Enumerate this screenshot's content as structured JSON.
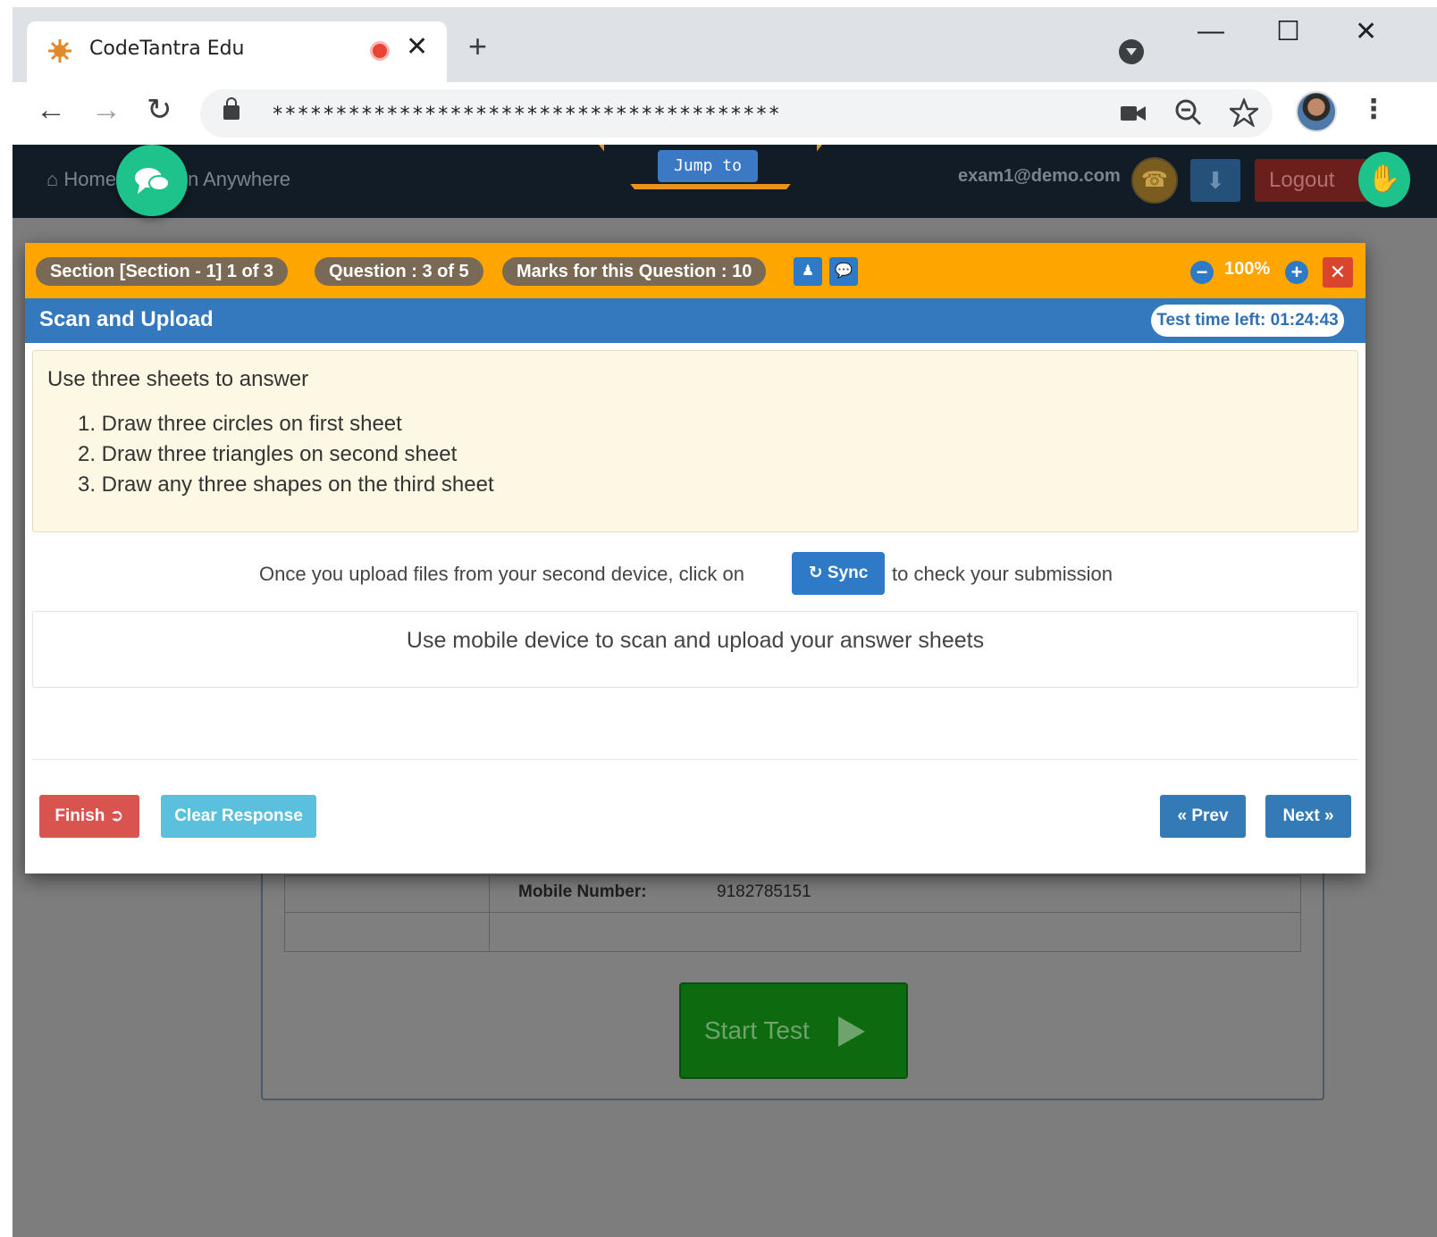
{
  "browser": {
    "tab_title": "CodeTantra Edu",
    "tab_close": "✕",
    "new_tab": "+",
    "url": "****************************************",
    "window_controls": {
      "minimize": "—",
      "maximize": "☐",
      "close": "✕"
    },
    "nav": {
      "back": "←",
      "forward": "→",
      "reload": "↻"
    },
    "icons": {
      "camera": "camera-icon",
      "zoom": "zoom-out-icon",
      "star": "star-icon",
      "menu": "more-vert-icon"
    }
  },
  "site_nav": {
    "home": "Home",
    "anywhere": "n Anywhere",
    "jump_to": "Jump to",
    "email": "exam1@demo.com",
    "logout": "Logout"
  },
  "background": {
    "mobile_label": "Mobile Number:",
    "mobile_value": "9182785151",
    "start_test": "Start Test"
  },
  "modal": {
    "section": "Section [Section - 1] 1 of 3",
    "question": "Question : 3 of 5",
    "marks": "Marks for this Question : 10",
    "zoom": "100%",
    "title": "Scan and Upload",
    "timer": "Test time left: 01:24:43",
    "prompt_intro": "Use three sheets to answer",
    "steps": [
      "1.  Draw three circles on first sheet",
      "2.  Draw three triangles on second sheet",
      "3.  Draw any three shapes on the third sheet"
    ],
    "sync_pre": "Once you upload files from your second device, click on",
    "sync_label": "Sync",
    "sync_post": "to check your submission",
    "scan_text": "Use mobile device to scan and upload your answer sheets",
    "finish": "Finish",
    "clear": "Clear Response",
    "prev": "« Prev",
    "next": "Next »"
  },
  "colors": {
    "orange_bar": "#ffa500",
    "title_blue": "#3478be",
    "finish_red": "#d9534f",
    "clear_teal": "#5bc0de",
    "nav_blue": "#337ab7",
    "prompt_bg": "#fcf8e3"
  }
}
